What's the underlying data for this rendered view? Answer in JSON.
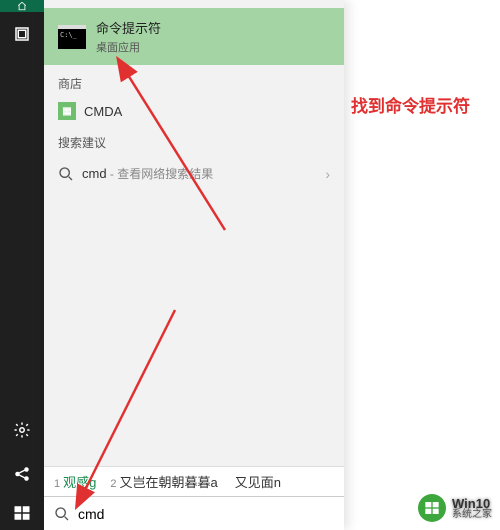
{
  "taskbar": {
    "home_icon": "home-icon",
    "library_icon": "library-icon",
    "settings_icon": "settings-icon",
    "share_icon": "share-icon",
    "start_icon": "windows-start-icon"
  },
  "best_match": {
    "title": "命令提示符",
    "subtitle": "桌面应用",
    "icon_text": "C:\\_"
  },
  "sections": {
    "store_header": "商店",
    "store_item": "CMDA",
    "suggest_header": "搜索建议",
    "suggest_query": "cmd",
    "suggest_tail": " - 查看网络搜索结果"
  },
  "ime": {
    "candidates": [
      {
        "num": "1",
        "text": "观感g"
      },
      {
        "num": "2",
        "text": "又岂在朝朝暮暮a"
      },
      {
        "num": "",
        "text": "又见面n"
      }
    ]
  },
  "search": {
    "value": "cmd",
    "placeholder": ""
  },
  "annotation": {
    "text": "找到命令提示符"
  },
  "watermark": {
    "top": "Win10",
    "bottom": "系统之家"
  }
}
